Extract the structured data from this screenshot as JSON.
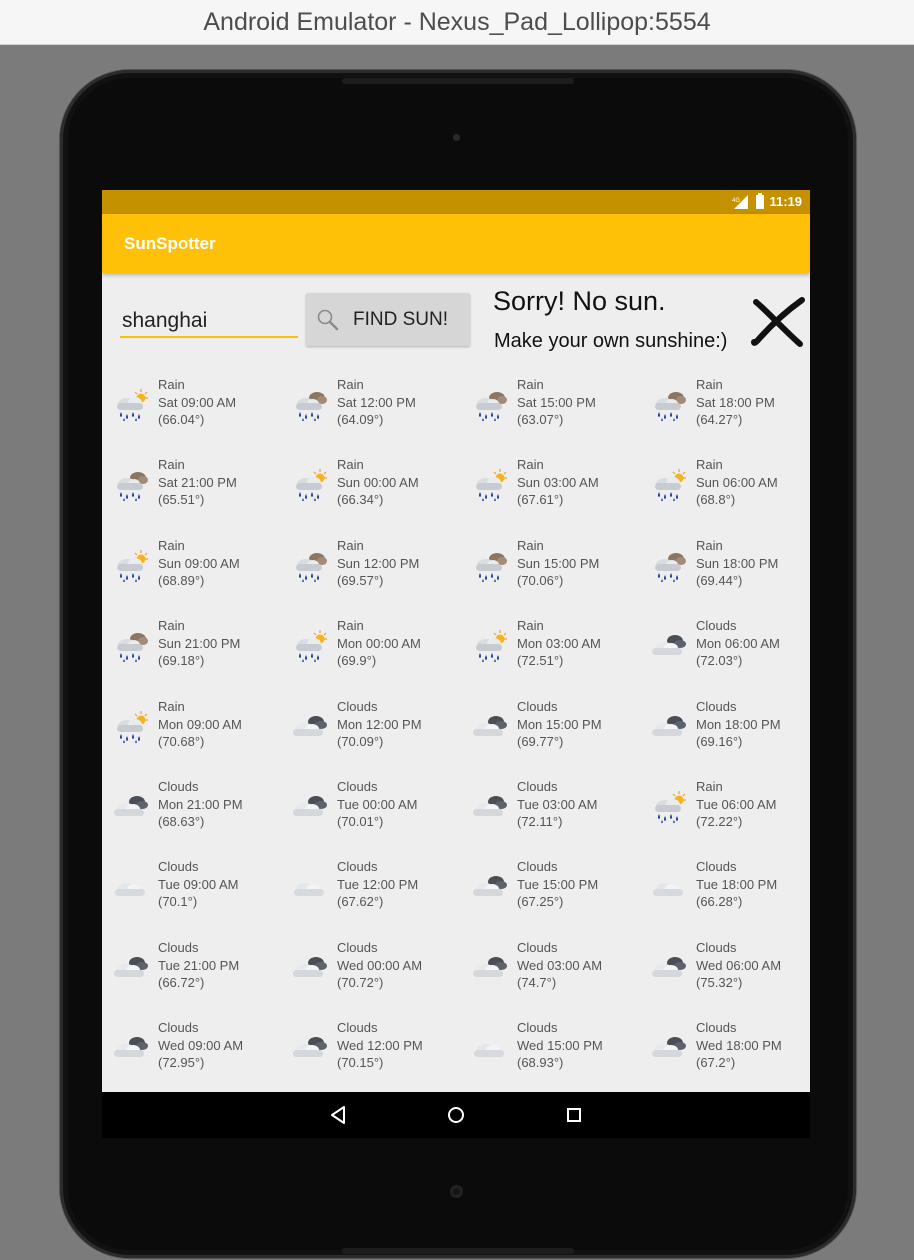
{
  "window": {
    "title": "Android Emulator - Nexus_Pad_Lollipop:5554"
  },
  "status_bar": {
    "time": "11:19",
    "signal_icon": "signal-4g-icon",
    "battery_icon": "battery-charging-icon"
  },
  "app_bar": {
    "title": "SunSpotter"
  },
  "search": {
    "value": "shanghai",
    "placeholder": ""
  },
  "find_button": {
    "label": "FIND SUN!",
    "icon": "search-icon"
  },
  "result": {
    "headline": "Sorry! No sun.",
    "subline": "Make your own sunshine:)",
    "icon": "cross-icon"
  },
  "colors": {
    "primary": "#ffc107",
    "primary_dark": "#c49100",
    "screen_background": "#eeeeee",
    "text_secondary": "#555555"
  },
  "forecast": [
    {
      "condition": "Rain",
      "time": "Sat 09:00 AM",
      "temp": "(66.04°)",
      "icon": "rain-sun-icon"
    },
    {
      "condition": "Rain",
      "time": "Sat 12:00 PM",
      "temp": "(64.09°)",
      "icon": "rain-cloud-icon"
    },
    {
      "condition": "Rain",
      "time": "Sat 15:00 PM",
      "temp": "(63.07°)",
      "icon": "rain-cloud-icon"
    },
    {
      "condition": "Rain",
      "time": "Sat 18:00 PM",
      "temp": "(64.27°)",
      "icon": "rain-cloud-icon"
    },
    {
      "condition": "Rain",
      "time": "Sat 21:00 PM",
      "temp": "(65.51°)",
      "icon": "rain-cloud-icon"
    },
    {
      "condition": "Rain",
      "time": "Sun 00:00 AM",
      "temp": "(66.34°)",
      "icon": "rain-sun-icon"
    },
    {
      "condition": "Rain",
      "time": "Sun 03:00 AM",
      "temp": "(67.61°)",
      "icon": "rain-sun-icon"
    },
    {
      "condition": "Rain",
      "time": "Sun 06:00 AM",
      "temp": "(68.8°)",
      "icon": "rain-sun-icon"
    },
    {
      "condition": "Rain",
      "time": "Sun 09:00 AM",
      "temp": "(68.89°)",
      "icon": "rain-sun-icon"
    },
    {
      "condition": "Rain",
      "time": "Sun 12:00 PM",
      "temp": "(69.57°)",
      "icon": "rain-cloud-icon"
    },
    {
      "condition": "Rain",
      "time": "Sun 15:00 PM",
      "temp": "(70.06°)",
      "icon": "rain-cloud-icon"
    },
    {
      "condition": "Rain",
      "time": "Sun 18:00 PM",
      "temp": "(69.44°)",
      "icon": "rain-cloud-icon"
    },
    {
      "condition": "Rain",
      "time": "Sun 21:00 PM",
      "temp": "(69.18°)",
      "icon": "rain-cloud-icon"
    },
    {
      "condition": "Rain",
      "time": "Mon 00:00 AM",
      "temp": "(69.9°)",
      "icon": "rain-sun-icon"
    },
    {
      "condition": "Rain",
      "time": "Mon 03:00 AM",
      "temp": "(72.51°)",
      "icon": "rain-sun-icon"
    },
    {
      "condition": "Clouds",
      "time": "Mon 06:00 AM",
      "temp": "(72.03°)",
      "icon": "dark-clouds-icon"
    },
    {
      "condition": "Rain",
      "time": "Mon 09:00 AM",
      "temp": "(70.68°)",
      "icon": "rain-sun-icon"
    },
    {
      "condition": "Clouds",
      "time": "Mon 12:00 PM",
      "temp": "(70.09°)",
      "icon": "dark-clouds-icon"
    },
    {
      "condition": "Clouds",
      "time": "Mon 15:00 PM",
      "temp": "(69.77°)",
      "icon": "dark-clouds-icon"
    },
    {
      "condition": "Clouds",
      "time": "Mon 18:00 PM",
      "temp": "(69.16°)",
      "icon": "dark-clouds-icon"
    },
    {
      "condition": "Clouds",
      "time": "Mon 21:00 PM",
      "temp": "(68.63°)",
      "icon": "dark-clouds-icon"
    },
    {
      "condition": "Clouds",
      "time": "Tue 00:00 AM",
      "temp": "(70.01°)",
      "icon": "dark-clouds-icon"
    },
    {
      "condition": "Clouds",
      "time": "Tue 03:00 AM",
      "temp": "(72.11°)",
      "icon": "dark-clouds-icon"
    },
    {
      "condition": "Rain",
      "time": "Tue 06:00 AM",
      "temp": "(72.22°)",
      "icon": "rain-sun-icon"
    },
    {
      "condition": "Clouds",
      "time": "Tue 09:00 AM",
      "temp": "(70.1°)",
      "icon": "light-cloud-icon"
    },
    {
      "condition": "Clouds",
      "time": "Tue 12:00 PM",
      "temp": "(67.62°)",
      "icon": "light-cloud-icon"
    },
    {
      "condition": "Clouds",
      "time": "Tue 15:00 PM",
      "temp": "(67.25°)",
      "icon": "dark-clouds-icon"
    },
    {
      "condition": "Clouds",
      "time": "Tue 18:00 PM",
      "temp": "(66.28°)",
      "icon": "light-cloud-icon"
    },
    {
      "condition": "Clouds",
      "time": "Tue 21:00 PM",
      "temp": "(66.72°)",
      "icon": "dark-clouds-icon"
    },
    {
      "condition": "Clouds",
      "time": "Wed 00:00 AM",
      "temp": "(70.72°)",
      "icon": "dark-clouds-icon"
    },
    {
      "condition": "Clouds",
      "time": "Wed 03:00 AM",
      "temp": "(74.7°)",
      "icon": "dark-clouds-icon"
    },
    {
      "condition": "Clouds",
      "time": "Wed 06:00 AM",
      "temp": "(75.32°)",
      "icon": "dark-clouds-icon"
    },
    {
      "condition": "Clouds",
      "time": "Wed 09:00 AM",
      "temp": "(72.95°)",
      "icon": "dark-clouds-icon"
    },
    {
      "condition": "Clouds",
      "time": "Wed 12:00 PM",
      "temp": "(70.15°)",
      "icon": "dark-clouds-icon"
    },
    {
      "condition": "Clouds",
      "time": "Wed 15:00 PM",
      "temp": "(68.93°)",
      "icon": "light-cloud-icon"
    },
    {
      "condition": "Clouds",
      "time": "Wed 18:00 PM",
      "temp": "(67.2°)",
      "icon": "dark-clouds-icon"
    }
  ],
  "nav_bar": {
    "back_icon": "back-icon",
    "home_icon": "home-icon",
    "recents_icon": "recents-icon"
  }
}
